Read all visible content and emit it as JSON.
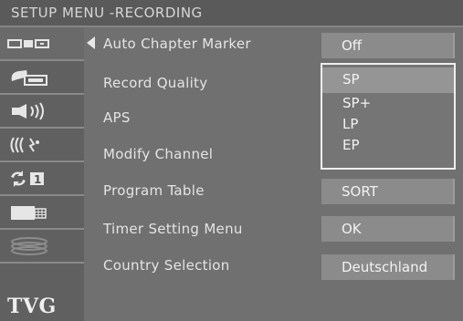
{
  "title": "SETUP MENU -RECORDING",
  "sidebar": {
    "items": [
      {
        "icon": "recording-icon"
      },
      {
        "icon": "display-icon"
      },
      {
        "icon": "audio-icon"
      },
      {
        "icon": "language-icon"
      },
      {
        "icon": "channel-icon"
      },
      {
        "icon": "tv-screen-icon"
      },
      {
        "icon": "disc-icon"
      },
      {
        "icon": "tvg-icon",
        "label": "TVG"
      }
    ]
  },
  "menu": {
    "rows": [
      {
        "label": "Auto Chapter Marker",
        "value": "Off"
      },
      {
        "label": "Record Quality",
        "value": ""
      },
      {
        "label": "APS",
        "value": ""
      },
      {
        "label": "Modify Channel",
        "value": ""
      },
      {
        "label": "Program Table",
        "value": "SORT"
      },
      {
        "label": "Timer Setting Menu",
        "value": "OK"
      },
      {
        "label": "Country Selection",
        "value": "Deutschland"
      }
    ]
  },
  "dropdown": {
    "options": [
      "SP",
      "SP+",
      "LP",
      "EP"
    ],
    "selected": "SP"
  },
  "colors": {
    "background": "#707070",
    "title_bar": "#5a5a5a",
    "value_box": "#8b8b8b",
    "selected_option": "#959595",
    "text": "#e4e4e4"
  }
}
